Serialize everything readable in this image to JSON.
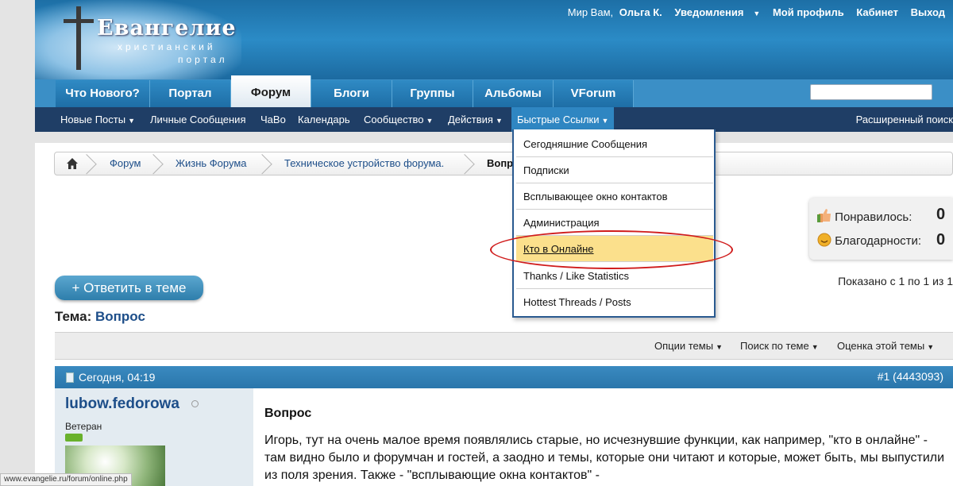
{
  "logo": {
    "title": "Евангелие",
    "sub1": "христианский",
    "sub2": "портал"
  },
  "toplinks": {
    "greeting": "Мир Вам,",
    "user": "Ольга К.",
    "notifications": "Уведомления",
    "profile": "Мой профиль",
    "cabinet": "Кабинет",
    "logout": "Выход"
  },
  "navtabs": [
    {
      "label": "Что Нового?"
    },
    {
      "label": "Портал"
    },
    {
      "label": "Форум",
      "active": true
    },
    {
      "label": "Блоги"
    },
    {
      "label": "Группы"
    },
    {
      "label": "Альбомы"
    },
    {
      "label": "VForum"
    }
  ],
  "subnav": {
    "items": [
      {
        "label": "Новые Посты",
        "dropdown": true
      },
      {
        "label": "Личные Сообщения"
      },
      {
        "label": "ЧаВо"
      },
      {
        "label": "Календарь"
      },
      {
        "label": "Сообщество",
        "dropdown": true
      },
      {
        "label": "Действия",
        "dropdown": true
      },
      {
        "label": "Быстрые Ссылки",
        "dropdown": true,
        "active": true
      }
    ],
    "advanced_search": "Расширенный поиск"
  },
  "breadcrumb": [
    "Форум",
    "Жизнь Форума",
    "Техническое устройство форума.",
    "Вопр"
  ],
  "quick_links_menu": [
    {
      "label": "Сегодняшние Сообщения"
    },
    {
      "label": "Подписки"
    },
    {
      "label": "Всплывающее окно контактов"
    },
    {
      "label": "Администрация"
    },
    {
      "label": "Кто в Онлайне",
      "highlighted": true
    },
    {
      "label": "Thanks / Like Statistics"
    },
    {
      "label": "Hottest Threads / Posts"
    }
  ],
  "ratings": {
    "likes_label": "Понравилось:",
    "likes_value": "0",
    "thanks_label": "Благодарности:",
    "thanks_value": "0"
  },
  "shown_text": "Показано с 1 по 1 из 1",
  "reply_button": "+ Ответить в теме",
  "thread": {
    "prefix": "Тема:",
    "title": "Вопрос"
  },
  "toolbar": {
    "options": "Опции темы",
    "search": "Поиск по теме",
    "rating": "Оценка этой темы"
  },
  "post": {
    "date": "Сегодня, 04:19",
    "number": "#1 (4443093)",
    "username": "lubow.fedorowa",
    "rank": "Ветеран",
    "title": "Вопрос",
    "text": "Игорь, тут на очень малое время появлялись старые, но исчезнувшие функции, как например, \"кто в онлайне\" - там видно было и форумчан и гостей, а заодно и темы, которые они читают и которые, может быть, мы выпустили из поля зрения. Также - \"всплывающие окна контактов\" -"
  },
  "statusbar_url": "www.evangelie.ru/forum/online.php",
  "colors": {
    "header_blue": "#2b8bc6",
    "subnav_dark": "#1f3e66",
    "highlight_yellow": "#fbe08c",
    "annotation_red": "#d01c1c",
    "link_blue": "#1d4e89"
  }
}
